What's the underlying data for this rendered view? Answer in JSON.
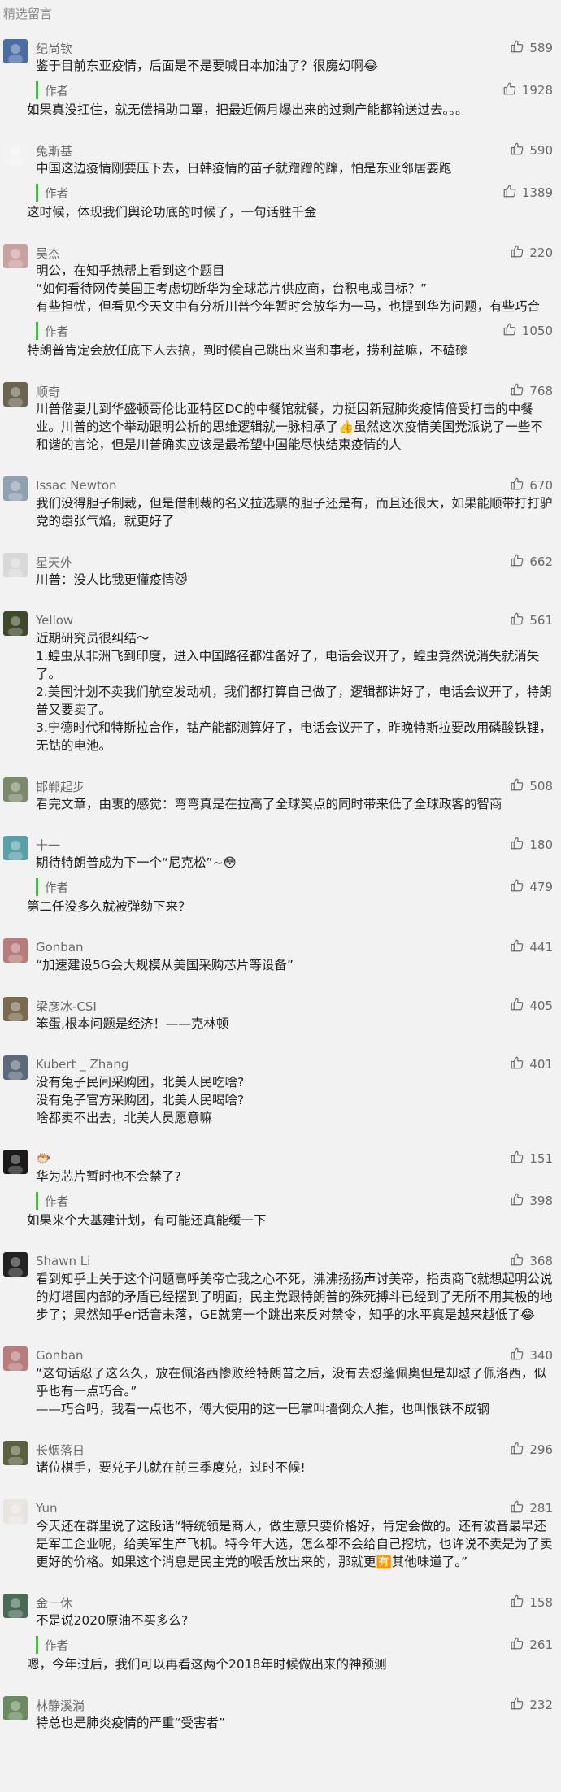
{
  "header": {
    "title": "精选留言"
  },
  "comments": [
    {
      "nickname": "纪尚钦",
      "likes": "589",
      "text": "鉴于目前东亚疫情，后面是不是要喊日本加油了？很魔幻啊😂",
      "reply": {
        "author": "作者",
        "likes": "1928",
        "text": "如果真没扛住，就无偿捐助口罩，把最近俩月爆出来的过剩产能都输送过去。。。"
      },
      "avatar": "#4a6da3"
    },
    {
      "nickname": "兔斯基",
      "likes": "590",
      "text": "中国这边疫情刚要压下去，日韩疫情的苗子就蹭蹭的蹿，怕是东亚邻居要跑",
      "reply": {
        "author": "作者",
        "likes": "1389",
        "text": "这时候，体现我们舆论功底的时候了，一句话胜千金"
      },
      "avatar": "#f3f3f3"
    },
    {
      "nickname": "吴杰",
      "likes": "220",
      "text": "明公，在知乎热帮上看到这个题目\n“如何看待网传美国正考虑切断华为全球芯片供应商，台积电成目标？”\n有些担忧，但看见今天文中有分析川普今年暂时会放华为一马，也提到华为问题，有些巧合",
      "reply": {
        "author": "作者",
        "likes": "1050",
        "text": "特朗普肯定会放任底下人去搞，到时候自己跳出来当和事老，捞利益嘛，不磕碜"
      },
      "avatar": "#c9a1a1"
    },
    {
      "nickname": "顺奇",
      "likes": "768",
      "text": "川普偕妻儿到华盛顿哥伦比亚特区DC的中餐馆就餐，力挺因新冠肺炎疫情倍受打击的中餐业。川普的这个举动跟明公析的思维逻辑就一脉相承了👍虽然这次疫情美国党派说了一些不和谐的言论，但是川普确实应该是最希望中国能尽快结束疫情的人",
      "avatar": "#6b6550"
    },
    {
      "nickname": "Issac Newton",
      "likes": "670",
      "text": "我们没得胆子制裁，但是借制裁的名义拉选票的胆子还是有，而且还很大，如果能顺带打打驴党的嚣张气焰，就更好了",
      "avatar": "#8fa0b0"
    },
    {
      "nickname": "星天外",
      "likes": "662",
      "text": "川普：没人比我更懂疫情😼",
      "avatar": "#d8d8d8"
    },
    {
      "nickname": "Yellow",
      "likes": "561",
      "text": "近期研究员很纠结～\n1.蝗虫从非洲飞到印度，进入中国路径都准备好了，电话会议开了，蝗虫竟然说消失就消失了。\n2.美国计划不卖我们航空发动机，我们都打算自己做了，逻辑都讲好了，电话会议开了，特朗普又要卖了。\n3.宁德时代和特斯拉合作，钴产能都测算好了，电话会议开了，昨晚特斯拉要改用磷酸铁锂，无钴的电池。",
      "avatar": "#3e4a2a"
    },
    {
      "nickname": "邯郸起步",
      "likes": "508",
      "text": "看完文章，由衷的感觉：弯弯真是在拉高了全球笑点的同时带来低了全球政客的智商",
      "avatar": "#7a8a6a"
    },
    {
      "nickname": "十一",
      "likes": "180",
      "text": "期待特朗普成为下一个“尼克松”~😳",
      "reply": {
        "author": "作者",
        "likes": "479",
        "text": "第二任没多久就被弹劾下来？"
      },
      "avatar": "#5aa0a8"
    },
    {
      "nickname": "Gonban",
      "likes": "441",
      "text": "“加速建设5G会大规模从美国采购芯片等设备”",
      "avatar": "#b87c7c"
    },
    {
      "nickname": "梁彦冰-CSI",
      "likes": "405",
      "text": "笨蛋,根本问题是经济！——克林顿",
      "avatar": "#7a6a50"
    },
    {
      "nickname": "Kubert _ Zhang",
      "likes": "401",
      "text": "没有兔子民间采购团，北美人民吃啥?\n没有兔子官方采购团，北美人民喝啥?\n啥都卖不出去，北美人员愿意嘛",
      "avatar": "#5a6a7a"
    },
    {
      "nickname": "🐡",
      "likes": "151",
      "text": "华为芯片暂时也不会禁了?",
      "reply": {
        "author": "作者",
        "likes": "398",
        "text": "如果来个大基建计划，有可能还真能缓一下"
      },
      "avatar": "#1a1a1a"
    },
    {
      "nickname": "Shawn Li",
      "likes": "368",
      "text": "看到知乎上关于这个问题高呼美帝亡我之心不死，沸沸扬扬声讨美帝，指责商飞就想起明公说的灯塔国内部的矛盾已经摆到了明面，民主党跟特朗普的殊死搏斗已经到了无所不用其极的地步了；果然知乎er话音未落，GE就第一个跳出来反对禁令，知乎的水平真是越来越低了😂",
      "avatar": "#222222"
    },
    {
      "nickname": "Gonban",
      "likes": "340",
      "text": "“这句话忍了这么久，放在佩洛西惨败给特朗普之后，没有去怼蓬佩奥但是却怼了佩洛西，似乎也有一点巧合。”\n——巧合吗，我看一点也不，傅大使用的这一巴掌叫墙倒众人推，也叫恨铁不成钢",
      "avatar": "#b87c7c"
    },
    {
      "nickname": "长烟落日",
      "likes": "296",
      "text": "诸位棋手，要兑子儿就在前三季度兑，过时不候!",
      "avatar": "#5a6040"
    },
    {
      "nickname": "Yun",
      "likes": "281",
      "text": "今天还在群里说了这段话“特统领是商人，做生意只要价格好，肯定会做的。还有波音最早还是军工企业呢，给美军生产飞机。特今年大选，怎么都不会给自己挖坑，也许说不卖是为了卖更好的价格。如果这个消息是民主党的喉舌放出来的，那就更🈶其他味道了。”",
      "avatar": "#e8e4e0"
    },
    {
      "nickname": "金一休",
      "likes": "158",
      "text": "不是说2020原油不买多么?",
      "reply": {
        "author": "作者",
        "likes": "261",
        "text": "嗯，今年过后，我们可以再看这两个2018年时候做出来的神预测"
      },
      "avatar": "#4a6a58"
    },
    {
      "nickname": "林静溪淌",
      "likes": "232",
      "text": "特总也是肺炎疫情的严重“受害者”",
      "avatar": "#6a8a60"
    }
  ]
}
